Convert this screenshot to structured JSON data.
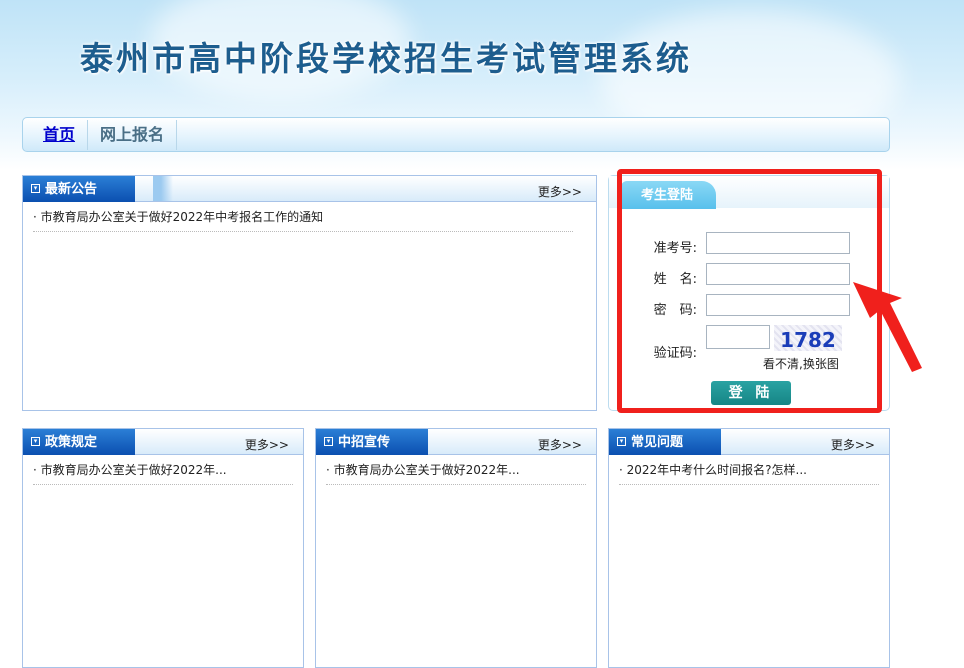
{
  "header": {
    "title": "泰州市高中阶段学校招生考试管理系统"
  },
  "nav": {
    "items": [
      {
        "label": "首页"
      },
      {
        "label": "网上报名"
      }
    ]
  },
  "panels": {
    "announcements": {
      "title": "最新公告",
      "more": "更多>>",
      "items": [
        "市教育局办公室关于做好2022年中考报名工作的通知"
      ]
    },
    "policy": {
      "title": "政策规定",
      "more": "更多>>",
      "items": [
        "市教育局办公室关于做好2022年..."
      ]
    },
    "promotion": {
      "title": "中招宣传",
      "more": "更多>>",
      "items": [
        "市教育局办公室关于做好2022年..."
      ]
    },
    "faq": {
      "title": "常见问题",
      "more": "更多>>",
      "items": [
        "2022年中考什么时间报名?怎样..."
      ]
    }
  },
  "login": {
    "title": "考生登陆",
    "exam_no_label": "准考号:",
    "name_label": "姓　名:",
    "password_label": "密　码:",
    "captcha_label": "验证码:",
    "captcha_text": "1782",
    "refresh_captcha": "看不清,换张图",
    "submit": "登 陆"
  },
  "colors": {
    "highlight": "#f0201c",
    "nav_blue": "#0b4fb0"
  }
}
